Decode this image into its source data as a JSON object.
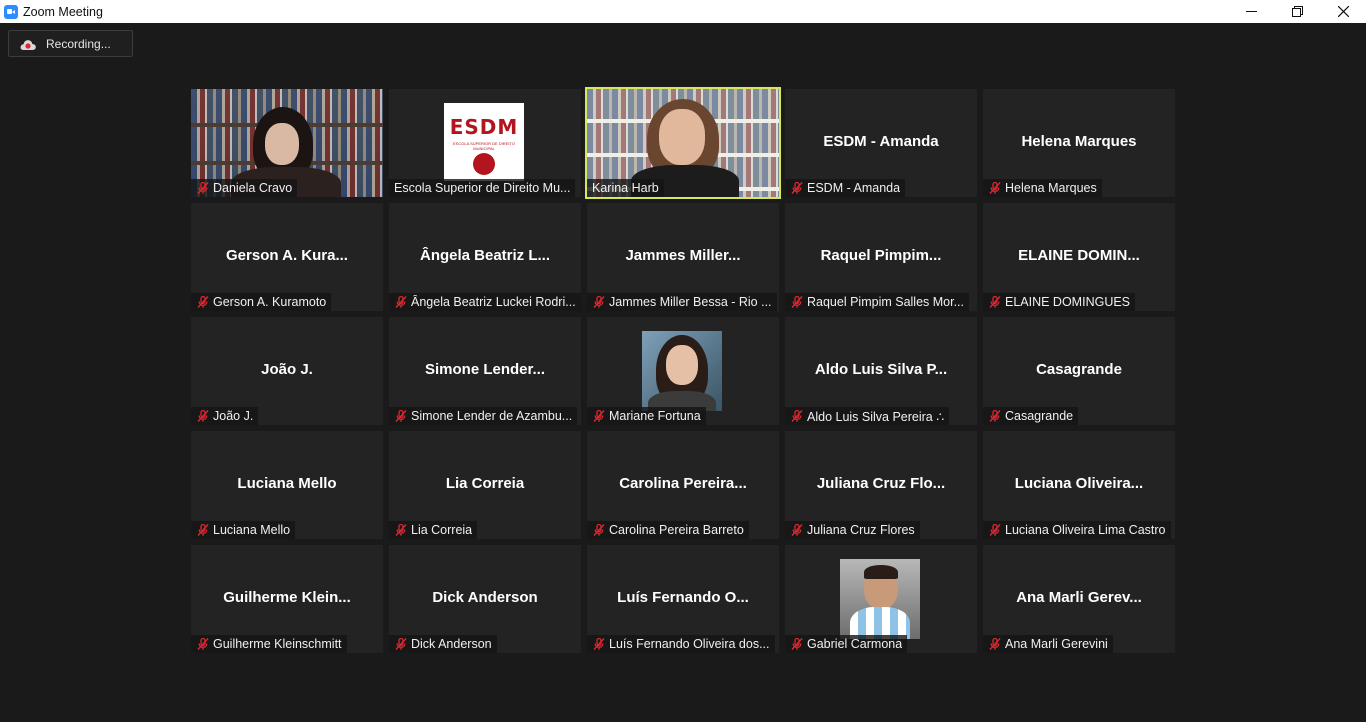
{
  "window": {
    "title": "Zoom Meeting"
  },
  "recording": {
    "label": "Recording..."
  },
  "colors": {
    "active_speaker_border": "#d5e85b",
    "muted_mic": "#e0262e",
    "background": "#1a1a1a",
    "tile": "#232323"
  },
  "participants": [
    {
      "display": "",
      "label": "Daniela Cravo",
      "muted": true,
      "video": "bookshelf-woman"
    },
    {
      "display": "",
      "label": "Escola Superior de Direito Mu...",
      "muted": false,
      "video": "esdm-logo"
    },
    {
      "display": "",
      "label": "Karina Harb",
      "muted": false,
      "video": "bookshelf-speaker",
      "active_speaker": true
    },
    {
      "display": "ESDM - Amanda",
      "label": "ESDM - Amanda",
      "muted": true
    },
    {
      "display": "Helena Marques",
      "label": "Helena Marques",
      "muted": true
    },
    {
      "display": "Gerson A. Kura...",
      "label": "Gerson A. Kuramoto",
      "muted": true
    },
    {
      "display": "Ângela Beatriz L...",
      "label": "Ângela Beatriz Luckei Rodri...",
      "muted": true
    },
    {
      "display": "Jammes Miller...",
      "label": "Jammes Miller Bessa - Rio ...",
      "muted": true
    },
    {
      "display": "Raquel Pimpim...",
      "label": "Raquel Pimpim Salles Mor...",
      "muted": true
    },
    {
      "display": "ELAINE DOMIN...",
      "label": "ELAINE DOMINGUES",
      "muted": true
    },
    {
      "display": "João J.",
      "label": "João J.",
      "muted": true
    },
    {
      "display": "Simone Lender...",
      "label": "Simone Lender de Azambu...",
      "muted": true
    },
    {
      "display": "",
      "label": "Mariane Fortuna",
      "muted": true,
      "video": "profile-photo-woman"
    },
    {
      "display": "Aldo Luis Silva P...",
      "label": "Aldo Luis Silva Pereira ∴",
      "muted": true
    },
    {
      "display": "Casagrande",
      "label": "Casagrande",
      "muted": true
    },
    {
      "display": "Luciana Mello",
      "label": "Luciana Mello",
      "muted": true
    },
    {
      "display": "Lia Correia",
      "label": "Lia Correia",
      "muted": true
    },
    {
      "display": "Carolina Pereira...",
      "label": "Carolina Pereira Barreto",
      "muted": true
    },
    {
      "display": "Juliana Cruz Flo...",
      "label": "Juliana Cruz Flores",
      "muted": true
    },
    {
      "display": "Luciana Oliveira...",
      "label": "Luciana Oliveira Lima Castro",
      "muted": true
    },
    {
      "display": "Guilherme Klein...",
      "label": "Guilherme Kleinschmitt",
      "muted": true
    },
    {
      "display": "Dick Anderson",
      "label": "Dick Anderson",
      "muted": true
    },
    {
      "display": "Luís Fernando O...",
      "label": "Luís Fernando Oliveira dos...",
      "muted": true
    },
    {
      "display": "",
      "label": "Gabriel Carmona",
      "muted": true,
      "video": "profile-photo-man"
    },
    {
      "display": "Ana Marli Gerev...",
      "label": "Ana Marli Gerevini",
      "muted": true
    }
  ],
  "logo": {
    "text": "ESDM"
  }
}
